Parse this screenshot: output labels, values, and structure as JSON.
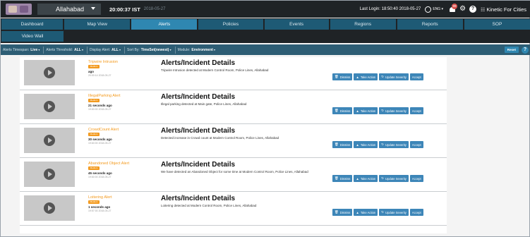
{
  "header": {
    "city": "Allahabad",
    "clock": "20:00:37 IST",
    "clock_date": "2018-05-27",
    "last_login": "Last Login: 18:50:40 2018-05-27",
    "language": "ENG ▾",
    "notification_count": "99",
    "brand": "Kinetic For Cities",
    "brand_mark": "☷"
  },
  "nav": {
    "row1": [
      {
        "label": "Dashboard",
        "active": false
      },
      {
        "label": "Map View",
        "active": false
      },
      {
        "label": "Alerts",
        "active": true
      },
      {
        "label": "Policies",
        "active": false
      },
      {
        "label": "Events",
        "active": false
      },
      {
        "label": "Regions",
        "active": false
      },
      {
        "label": "Reports",
        "active": false
      },
      {
        "label": "SOP",
        "active": false
      }
    ],
    "row2": [
      {
        "label": "Video Wall",
        "active": false
      }
    ]
  },
  "filters": [
    {
      "label": "Alerts Timespan:",
      "value": "Live"
    },
    {
      "label": "Alerts Threshold:",
      "value": "ALL"
    },
    {
      "label": "Display Alert:",
      "value": "ALL"
    },
    {
      "label": "Sort By:",
      "value": "TimeSet(newest)"
    },
    {
      "label": "Module:",
      "value": "Environment"
    }
  ],
  "reset_label": "Reset",
  "details_title": "Alerts/Incident Details",
  "severity_label": "Medium",
  "action_labels": {
    "dismiss": "Dismiss",
    "take_action": "Take Action",
    "update_severity": "Update Severity",
    "accept": "Accept"
  },
  "alerts": [
    {
      "name": "Tripwire Intrusion",
      "ago": "ago",
      "timestamp": "20:00:14 2018-05-27",
      "description": "Tripwire Intrusion detected at Modern Control Room, Police Lines, Allahabad"
    },
    {
      "name": "IllegalParking Alert",
      "ago": "21 seconds ago",
      "timestamp": "19:60:00 2018-05-27",
      "description": "Illegal parking detected at Main gate, Police Lines, Allahabad"
    },
    {
      "name": "CrowdCount Alert",
      "ago": "30 seconds ago",
      "timestamp": "19:60:00 2018-05-27",
      "description": "Detected increase in Crowd count at Modern Control Room, Police Lines, Allahabad"
    },
    {
      "name": "Abandoned Object Alert",
      "ago": "45 seconds ago",
      "timestamp": "19:60:00 2018-05-27",
      "description": "We have detected an Abandoned Object for some time at Modern Control Room, Police Lines, Allahabad"
    },
    {
      "name": "Loitering Alert",
      "ago": "1 seconds ago",
      "timestamp": "19:57:00 2018-05-27",
      "description": "Loitering detected at Modern Control Room, Police Lines, Allahabad"
    }
  ]
}
